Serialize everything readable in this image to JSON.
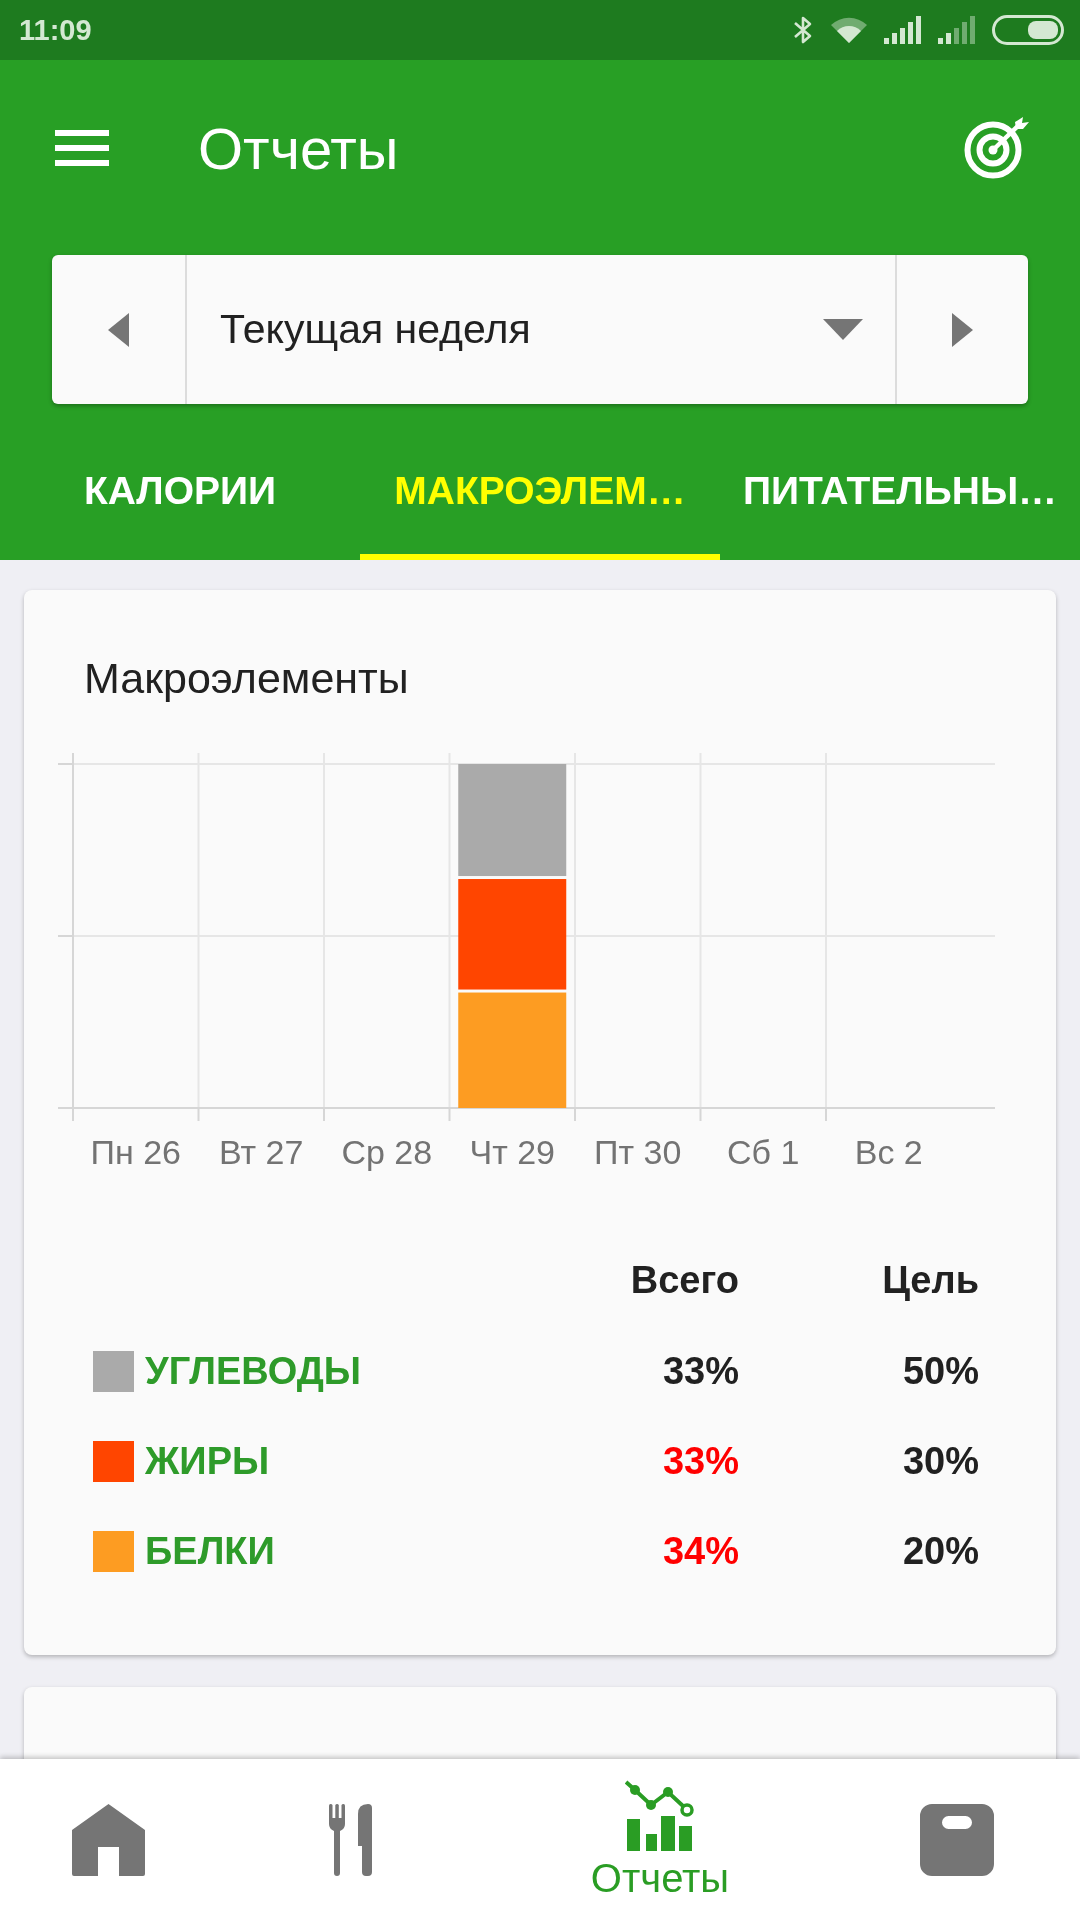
{
  "status_bar": {
    "time": "11:09"
  },
  "app_bar": {
    "title": "Отчеты"
  },
  "period_selector": {
    "value": "Текущая неделя"
  },
  "tabs": [
    {
      "label": "КАЛОРИИ",
      "selected": false
    },
    {
      "label": "МАКРОЭЛЕМ…",
      "selected": true
    },
    {
      "label": "ПИТАТЕЛЬНЫ…",
      "selected": false
    }
  ],
  "macros_card": {
    "title": "Макроэлементы",
    "chart": {
      "x_labels": [
        "Пн 26",
        "Вт 27",
        "Ср 28",
        "Чт 29",
        "Пт 30",
        "Сб 1",
        "Вс 2"
      ]
    },
    "table": {
      "columns": [
        "Всего",
        "Цель"
      ],
      "rows": [
        {
          "name": "УГЛЕВОДЫ",
          "color": "#aaaaaa",
          "total": "33%",
          "goal": "50%",
          "over_goal": false
        },
        {
          "name": "ЖИРЫ",
          "color": "#ff4500",
          "total": "33%",
          "goal": "30%",
          "over_goal": true
        },
        {
          "name": "БЕЛКИ",
          "color": "#fd9c22",
          "total": "34%",
          "goal": "20%",
          "over_goal": true
        }
      ]
    }
  },
  "bottom_nav": {
    "items": [
      {
        "selected": false
      },
      {
        "selected": false
      },
      {
        "label": "Отчеты",
        "selected": true
      },
      {
        "selected": false
      }
    ]
  }
}
